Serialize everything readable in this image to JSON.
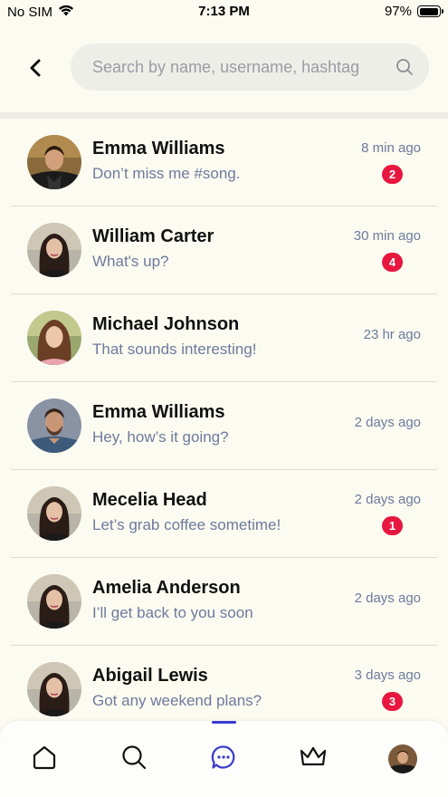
{
  "status_bar": {
    "carrier": "No SIM",
    "time": "7:13 PM",
    "battery": "97%",
    "battery_level": 0.97
  },
  "header": {
    "back_icon": "chevron-left-icon",
    "search": {
      "placeholder": "Search by name, username, hashtag",
      "value": "",
      "icon": "search-icon"
    }
  },
  "colors": {
    "background": "#fcfbf1",
    "badge": "#e8173f",
    "secondary_text": "#6d7a9c",
    "accent": "#3b3bd0"
  },
  "chats": [
    {
      "name": "Emma Williams",
      "message": "Don’t miss me #song.",
      "time": "8 min ago",
      "unread": "2",
      "avatar": "man-dark-jacket"
    },
    {
      "name": "William Carter",
      "message": "What's up?",
      "time": "30 min ago",
      "unread": "4",
      "avatar": "woman-dark-hair"
    },
    {
      "name": "Michael Johnson",
      "message": "That sounds interesting!",
      "time": "23 hr ago",
      "unread": null,
      "avatar": "woman-pink-top"
    },
    {
      "name": "Emma Williams",
      "message": "Hey, how’s it going?",
      "time": "2 days ago",
      "unread": null,
      "avatar": "man-denim-shirt"
    },
    {
      "name": "Mecelia Head",
      "message": "Let’s grab coffee sometime!",
      "time": "2 days ago",
      "unread": "1",
      "avatar": "woman-dark-hair"
    },
    {
      "name": "Amelia Anderson",
      "message": "I’ll get back to you soon",
      "time": "2 days ago",
      "unread": null,
      "avatar": "woman-dark-hair"
    },
    {
      "name": "Abigail Lewis",
      "message": "Got any weekend plans?",
      "time": "3 days ago",
      "unread": "3",
      "avatar": "woman-dark-hair"
    }
  ],
  "bottom_nav": {
    "items": [
      {
        "icon": "home-icon",
        "active": false
      },
      {
        "icon": "search-icon",
        "active": false
      },
      {
        "icon": "chat-bubble-icon",
        "active": true
      },
      {
        "icon": "crown-icon",
        "active": false
      },
      {
        "icon": "profile-avatar",
        "active": false
      }
    ]
  }
}
